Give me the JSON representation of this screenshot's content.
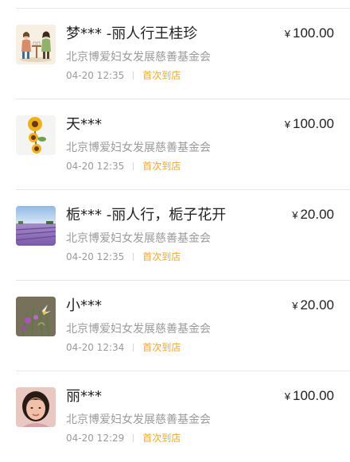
{
  "donations": [
    {
      "name": "梦*** -丽人行王桂珍",
      "currency": "¥",
      "amount": "100.00",
      "organization": "北京博爱妇女发展慈善基金会",
      "time": "04-20 12:35",
      "tag": "首次到店",
      "avatar": "couple-cafe-illustration"
    },
    {
      "name": "天***",
      "currency": "¥",
      "amount": "100.00",
      "organization": "北京博爱妇女发展慈善基金会",
      "time": "04-20 12:35",
      "tag": "首次到店",
      "avatar": "sunflowers-photo"
    },
    {
      "name": "栀*** -丽人行，栀子花开",
      "currency": "¥",
      "amount": "20.00",
      "organization": "北京博爱妇女发展慈善基金会",
      "time": "04-20 12:35",
      "tag": "首次到店",
      "avatar": "lavender-field-photo"
    },
    {
      "name": "小***",
      "currency": "¥",
      "amount": "20.00",
      "organization": "北京博爱妇女发展慈善基金会",
      "time": "04-20 12:34",
      "tag": "首次到店",
      "avatar": "wild-flowers-photo"
    },
    {
      "name": "丽***",
      "currency": "¥",
      "amount": "100.00",
      "organization": "北京博爱妇女发展慈善基金会",
      "time": "04-20 12:29",
      "tag": "首次到店",
      "avatar": "portrait-photo"
    }
  ],
  "colors": {
    "tag": "#f5a623",
    "primary_text": "#222222",
    "secondary_text": "#9a9a9a",
    "divider": "#e5e5e5"
  }
}
